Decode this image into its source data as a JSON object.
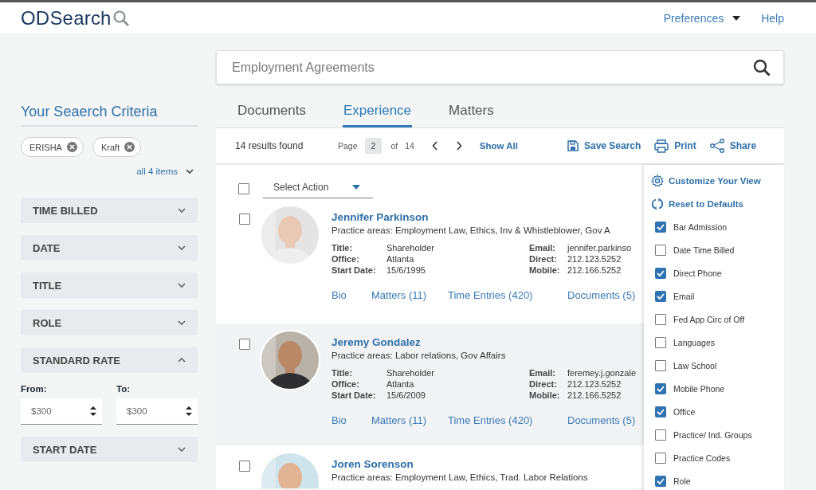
{
  "header": {
    "logo": "ODSearch",
    "menu": [
      {
        "label": "Preferences",
        "kind": "dropdown"
      },
      {
        "label": "Help",
        "kind": "link"
      }
    ]
  },
  "sidebar": {
    "title": "Your Seaerch Criteria",
    "chips": [
      {
        "label": "ERISHA"
      },
      {
        "label": "Kraft"
      }
    ],
    "more": "all 4 items",
    "filters": [
      {
        "label": "TIME BILLED",
        "expanded": false
      },
      {
        "label": "DATE",
        "expanded": false
      },
      {
        "label": "TITLE",
        "expanded": false
      },
      {
        "label": "ROLE",
        "expanded": false
      },
      {
        "label": "STANDARD RATE",
        "expanded": true,
        "fields": [
          {
            "label": "From:",
            "value": "$300"
          },
          {
            "label": "To:",
            "value": "$300"
          }
        ]
      },
      {
        "label": "START DATE",
        "expanded": false
      }
    ]
  },
  "search": {
    "placeholder": "Employment Agreements"
  },
  "tabs": [
    {
      "label": "Documents",
      "selected": false
    },
    {
      "label": "Experience",
      "selected": true
    },
    {
      "label": "Matters",
      "selected": false
    }
  ],
  "toolbar": {
    "results": "14 results found",
    "page_label": "Page",
    "page": "2",
    "of_label": "of",
    "total": "14",
    "show_all": "Show All",
    "actions": [
      "Save Search",
      "Print",
      "Share"
    ]
  },
  "select_all": {
    "checked": false
  },
  "action_select": {
    "value": "Select Action"
  },
  "results": [
    {
      "name": "Jennifer Parkinson",
      "checked": false,
      "practice_areas": "Practice areas: Employment Law, Ethics, Inv & Whistleblower, Gov A",
      "details": [
        {
          "label": "Title:",
          "value": "Shareholder"
        },
        {
          "label": "Email:",
          "value": "jennifer.parkinso"
        },
        {
          "label": "Office:",
          "value": "Atlanta"
        },
        {
          "label": "Direct:",
          "value": "212.123.5252"
        },
        {
          "label": "Start Date:",
          "value": "15/6/1995"
        },
        {
          "label": "Mobile:",
          "value": "212.166.5252"
        }
      ],
      "links": [
        "Bio",
        "Matters (11)",
        "Time Entries (420)",
        "Documents (5)"
      ]
    },
    {
      "name": "Jeremy Gondalez",
      "checked": false,
      "practice_areas": "Practice areas: Labor relations, Gov Affairs",
      "details": [
        {
          "label": "Title:",
          "value": "Shareholder"
        },
        {
          "label": "Email:",
          "value": "feremey.j.gonzale"
        },
        {
          "label": "Office:",
          "value": "Atlanta"
        },
        {
          "label": "Direct:",
          "value": "212.123.5252"
        },
        {
          "label": "Start Date:",
          "value": "15/6/2009"
        },
        {
          "label": "Mobile:",
          "value": "212.166.5252"
        }
      ],
      "links": [
        "Bio",
        "Matters (11)",
        "Time Entries (420)",
        "Documents (5)"
      ]
    },
    {
      "name": "Joren Sorenson",
      "checked": false,
      "practice_areas": "Practice areas: Employment Law, Ethics, Trad. Labor Relations"
    }
  ],
  "customize": {
    "title": "Customize Your View",
    "reset": "Reset to Defaults",
    "options": [
      {
        "label": "Bar Admission",
        "checked": true
      },
      {
        "label": "Date Time Billed",
        "checked": false
      },
      {
        "label": "Direct Phone",
        "checked": true
      },
      {
        "label": "Email",
        "checked": true
      },
      {
        "label": "Fed App Circ of Off",
        "checked": false
      },
      {
        "label": "Languages",
        "checked": false
      },
      {
        "label": "Law School",
        "checked": false
      },
      {
        "label": "Mobile Phone",
        "checked": true
      },
      {
        "label": "Office",
        "checked": true
      },
      {
        "label": "Practice/ Ind. Groups",
        "checked": false
      },
      {
        "label": "Practice Codes",
        "checked": false
      },
      {
        "label": "Role",
        "checked": true
      }
    ]
  }
}
